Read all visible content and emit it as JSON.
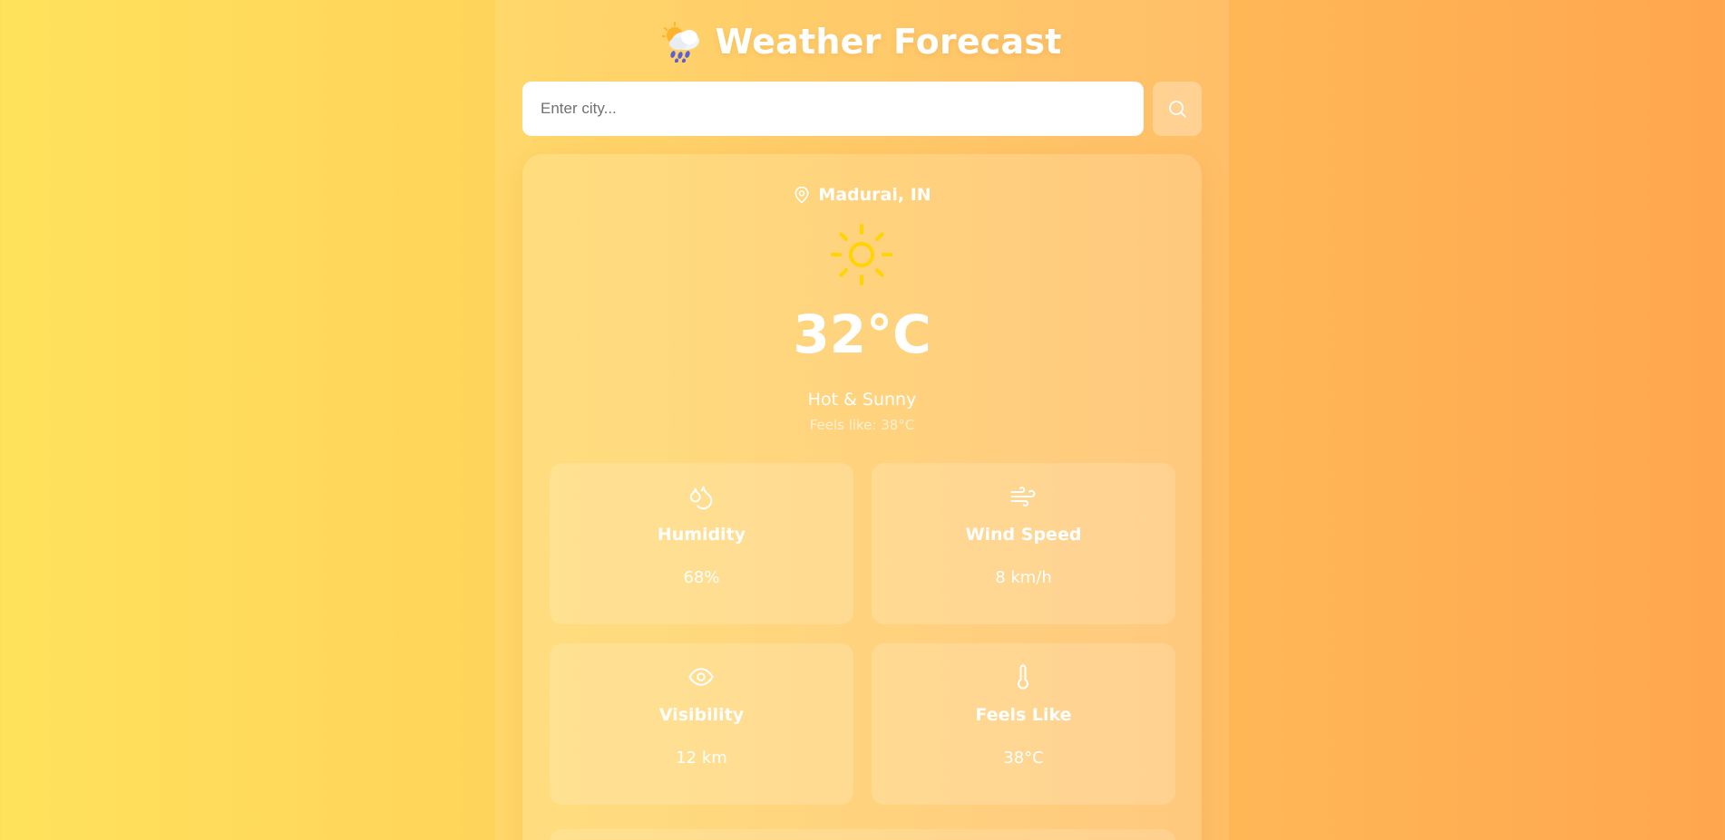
{
  "header": {
    "title": "Weather Forecast",
    "icon": "cloud-rain-sun-icon"
  },
  "search": {
    "placeholder": "Enter city...",
    "value": "",
    "button_icon": "search-icon"
  },
  "current": {
    "location": "Madurai, IN",
    "location_icon": "map-pin-icon",
    "weather_icon": "sun-icon",
    "temperature": "32°C",
    "condition": "Hot & Sunny",
    "feels_like_text": "Feels like: 38°C"
  },
  "stats": [
    {
      "label": "Humidity",
      "value": "68%",
      "icon": "droplets-icon"
    },
    {
      "label": "Wind Speed",
      "value": "8 km/h",
      "icon": "wind-icon"
    },
    {
      "label": "Visibility",
      "value": "12 km",
      "icon": "eye-icon"
    },
    {
      "label": "Feels Like",
      "value": "38°C",
      "icon": "thermometer-icon"
    }
  ],
  "colors": {
    "background_start": "#ffe25c",
    "background_end": "#ffa64f",
    "sun": "#ffd400",
    "text": "#ffffff"
  }
}
